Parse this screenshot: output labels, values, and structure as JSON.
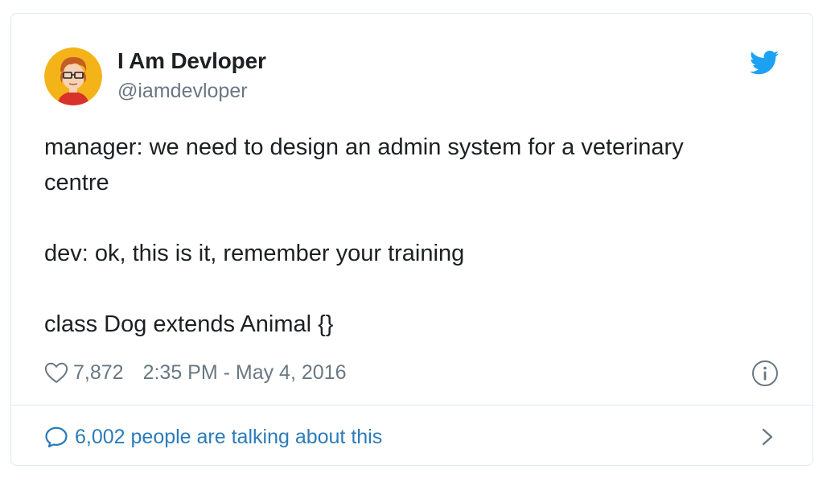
{
  "tweet": {
    "author_name": "I Am Devloper",
    "author_handle": "@iamdevloper",
    "text": "manager: we need to design an admin system for a veterinary\ncentre\n\ndev: ok, this is it, remember your training\n\nclass Dog extends Animal {}",
    "likes": "7,872",
    "timestamp": "2:35 PM - May 4, 2016",
    "conversation_text": "6,002 people are talking about this"
  },
  "icons": {
    "brand": "twitter-bird-icon",
    "like": "heart-icon",
    "info": "info-icon",
    "reply": "speech-bubble-icon",
    "more": "chevron-right-icon"
  },
  "colors": {
    "brand_blue": "#1da1f2",
    "link_blue": "#2b7bb9",
    "secondary_text": "#697882",
    "primary_text": "#1c2022",
    "border": "#e1e8ed",
    "avatar_bg": "#f5b31a"
  }
}
